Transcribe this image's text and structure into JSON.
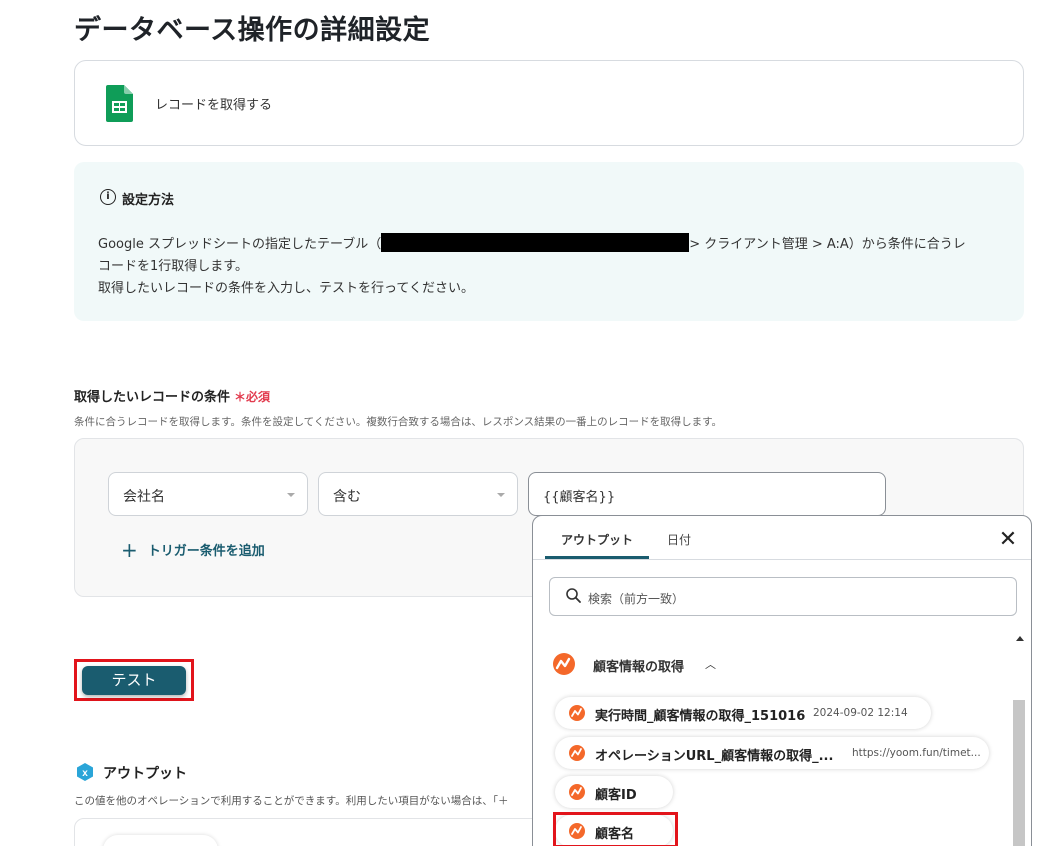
{
  "page": {
    "title": "データベース操作の詳細設定"
  },
  "action": {
    "label": "レコードを取得する"
  },
  "info": {
    "title": "設定方法",
    "line1_before": "Google スプレッドシートの指定したテーブル（",
    "line1_after": "> クライアント管理 > A:A）から条件に合うレ",
    "line2": "コードを1行取得します。",
    "line3": "取得したいレコードの条件を入力し、テストを行ってください。"
  },
  "conditions": {
    "title": "取得したいレコードの条件",
    "required_mark": "＊必須",
    "description": "条件に合うレコードを取得します。条件を設定してください。複数行合致する場合は、レスポンス結果の一番上のレコードを取得します。",
    "field_value": "会社名",
    "operator_value": "含む",
    "input_value": "{{顧客名}}",
    "add_label": "トリガー条件を追加"
  },
  "test": {
    "label": "テスト"
  },
  "output": {
    "title": "アウトプット",
    "description": "この値を他のオペレーションで利用することができます。利用したい項目がない場合は、「＋"
  },
  "dropdown": {
    "tabs": [
      "アウトプット",
      "日付"
    ],
    "search_placeholder": "検索（前方一致）",
    "group_label": "顧客情報の取得",
    "items": [
      {
        "name": "実行時間_顧客情報の取得_151016",
        "value": "2024-09-02 12:14"
      },
      {
        "name": "オペレーションURL_顧客情報の取得_...",
        "value": "https://yoom.fun/timet..."
      },
      {
        "name": "顧客ID",
        "value": ""
      },
      {
        "name": "顧客名",
        "value": ""
      }
    ]
  },
  "colors": {
    "accent": "#1a5c6f",
    "required": "#e23b4e",
    "highlight": "#e2141b",
    "sheets_green": "#0f9d58",
    "yoom_orange": "#f4682a"
  }
}
